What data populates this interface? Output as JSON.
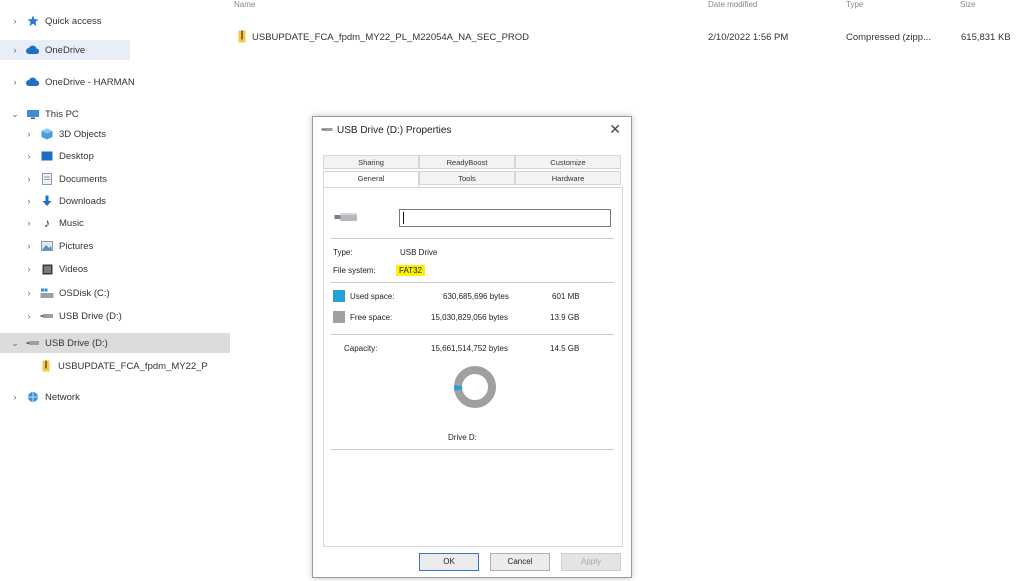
{
  "nav": {
    "quick_access": "Quick access",
    "onedrive": "OneDrive",
    "onedrive_harman": "OneDrive - HARMAN",
    "this_pc": "This PC",
    "objects3d": "3D Objects",
    "desktop": "Desktop",
    "documents": "Documents",
    "downloads": "Downloads",
    "music": "Music",
    "pictures": "Pictures",
    "videos": "Videos",
    "osdisk": "OSDisk (C:)",
    "usb_drive_pc": "USB Drive (D:)",
    "usb_drive_root": "USB Drive (D:)",
    "usb_file": "USBUPDATE_FCA_fpdm_MY22_P",
    "network": "Network"
  },
  "filelist": {
    "headers": {
      "name": "Name",
      "date": "Date modified",
      "type": "Type",
      "size": "Size"
    },
    "row": {
      "name": "USBUPDATE_FCA_fpdm_MY22_PL_M22054A_NA_SEC_PROD",
      "date": "2/10/2022 1:56 PM",
      "type": "Compressed (zipp...",
      "size": "615,831 KB"
    }
  },
  "dialog": {
    "title": "USB Drive (D:) Properties",
    "close": "✕",
    "tabs_top": [
      "Sharing",
      "ReadyBoost",
      "Customize"
    ],
    "tabs_bottom": [
      "General",
      "Tools",
      "Hardware"
    ],
    "type_label": "Type:",
    "type_value": "USB Drive",
    "fs_label": "File system:",
    "fs_value": "FAT32",
    "used_label": "Used space:",
    "used_bytes": "630,685,696 bytes",
    "used_size": "601 MB",
    "free_label": "Free space:",
    "free_bytes": "15,030,829,056 bytes",
    "free_size": "13.9 GB",
    "capacity_label": "Capacity:",
    "capacity_bytes": "15,661,514,752 bytes",
    "capacity_size": "14.5 GB",
    "drive_label": "Drive D:",
    "used_fraction": 0.04,
    "buttons": {
      "ok": "OK",
      "cancel": "Cancel",
      "apply": "Apply"
    },
    "colors": {
      "used": "#26a0da",
      "free": "#a0a0a0",
      "highlight": "#fff200"
    }
  }
}
